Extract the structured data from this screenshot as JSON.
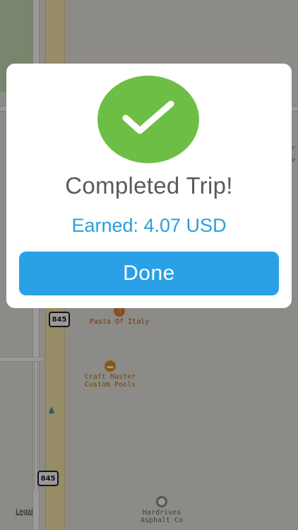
{
  "dialog": {
    "title": "Completed Trip!",
    "earned": "Earned: 4.07 USD",
    "done_label": "Done",
    "success_icon": "checkmark-icon",
    "colors": {
      "check_circle": "#6cbf44",
      "earned_text": "#2a9fdb",
      "done_button": "#2aa1e6",
      "title_text": "#5a5a5a"
    }
  },
  "map": {
    "route_shields": [
      "845",
      "845"
    ],
    "places": [
      {
        "name": "Pasta Of Italy",
        "icon": "restaurant-icon"
      },
      {
        "name": "Craft Master\nCustom Pools",
        "icon": "shop-icon"
      },
      {
        "name": "Hardrives\nAsphalt Co",
        "icon": "place-icon"
      }
    ],
    "legal_label": "Legal",
    "edge_text": {
      "right_1": "r",
      "right_2": "e"
    }
  }
}
